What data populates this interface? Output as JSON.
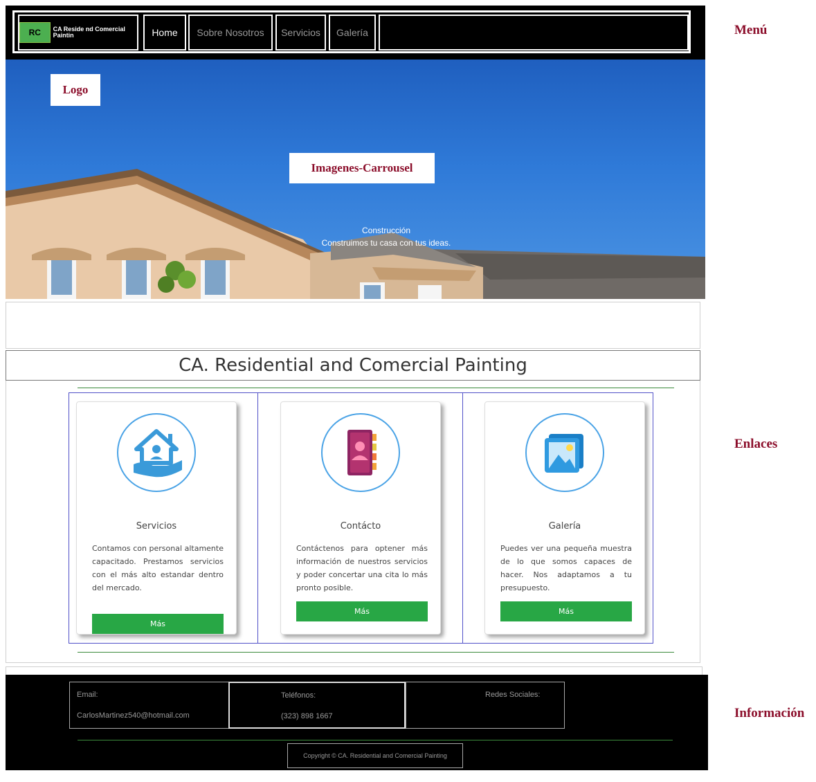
{
  "navbar": {
    "logo_mark": "RC",
    "logo_text": "CA Reside nd Comercial Paintin",
    "links": [
      {
        "label": "Home",
        "active": true
      },
      {
        "label": "Sobre Nosotros",
        "active": false
      },
      {
        "label": "Servicios",
        "active": false
      },
      {
        "label": "Galería",
        "active": false
      }
    ]
  },
  "annotations": {
    "logo_note": "Logo",
    "carousel_note": "Imagenes-Carrousel",
    "menu": "Menú",
    "links": "Enlaces",
    "info": "Información"
  },
  "hero": {
    "caption_title": "Construcción",
    "caption_subtitle": "Construimos tu casa con tus ideas."
  },
  "main": {
    "title": "CA. Residential and Comercial Painting",
    "cards": [
      {
        "icon": "house-hand-icon",
        "title": "Servicios",
        "text": "Contamos con personal altamente capacitado. Prestamos servicios con el más alto estandar dentro del mercado.",
        "button": "Más"
      },
      {
        "icon": "contact-book-icon",
        "title": "Contácto",
        "text": "Contáctenos para optener más información de nuestros servicios y poder concertar una cita lo más pronto posible.",
        "button": "Más"
      },
      {
        "icon": "gallery-image-icon",
        "title": "Galería",
        "text": "Puedes ver una pequeña muestra de lo que somos capaces de hacer. Nos adaptamos a tu presupuesto.",
        "button": "Más"
      }
    ]
  },
  "footer": {
    "email_label": "Email:",
    "email_value": "CarlosMartinez540@hotmail.com",
    "phone_label": "Teléfonos:",
    "phone_value": "(323) 898 1667",
    "social_label": "Redes Sociales:",
    "copyright": "Copyright © CA. Residential and Comercial Painting"
  },
  "colors": {
    "annotation": "#8b0d2a",
    "button": "#28a745",
    "card_border": "#5050c8",
    "icon_ring": "#4aa3e6"
  }
}
